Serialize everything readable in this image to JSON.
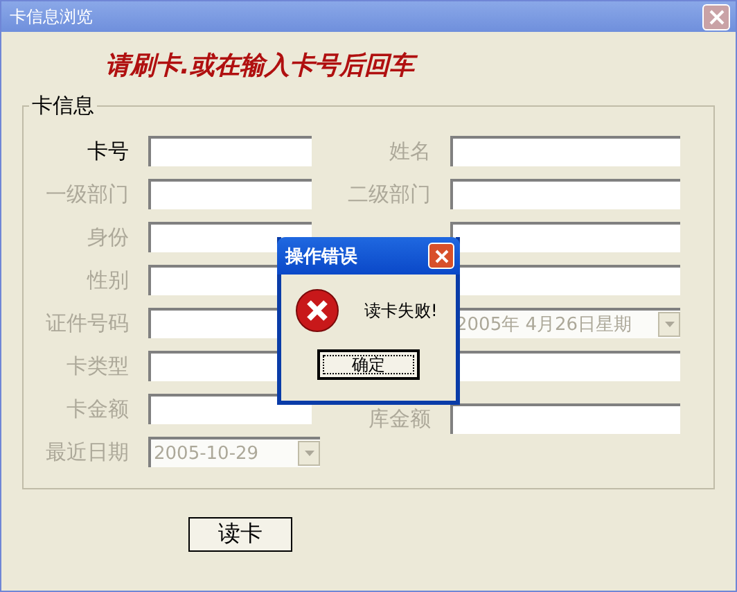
{
  "window": {
    "title": "卡信息浏览"
  },
  "prompt": "请刷卡.或在输入卡号后回车",
  "group": {
    "title": "卡信息",
    "rows": [
      {
        "left": {
          "label": "卡号",
          "disabled": false,
          "kind": "text"
        },
        "right": {
          "label": "姓名",
          "disabled": true,
          "kind": "text"
        }
      },
      {
        "left": {
          "label": "一级部门",
          "disabled": true,
          "kind": "text"
        },
        "right": {
          "label": "二级部门",
          "disabled": true,
          "kind": "text"
        }
      },
      {
        "left": {
          "label": "身份",
          "disabled": true,
          "kind": "text"
        },
        "right": {
          "kind": "text"
        }
      },
      {
        "left": {
          "label": "性别",
          "disabled": true,
          "kind": "text"
        },
        "right": {
          "kind": "text"
        }
      },
      {
        "left": {
          "label": "证件号码",
          "disabled": true,
          "kind": "text"
        },
        "right": {
          "disabled": true,
          "kind": "combo",
          "value": "2005年  4月26日星期"
        }
      },
      {
        "left": {
          "label": "卡类型",
          "disabled": true,
          "kind": "text"
        },
        "right": {
          "kind": "text"
        }
      },
      {
        "left": {
          "label": "卡金额",
          "disabled": true,
          "kind": "text"
        },
        "right": {
          "label": "库金额",
          "disabled": true,
          "kind": "text"
        }
      },
      {
        "left": {
          "label": "最近日期",
          "disabled": true,
          "kind": "combo",
          "value": "2005-10-29"
        }
      }
    ]
  },
  "read_button": "读卡",
  "dialog": {
    "title": "操作错误",
    "message": "读卡失败!",
    "button": "确定",
    "button_focused": true
  }
}
